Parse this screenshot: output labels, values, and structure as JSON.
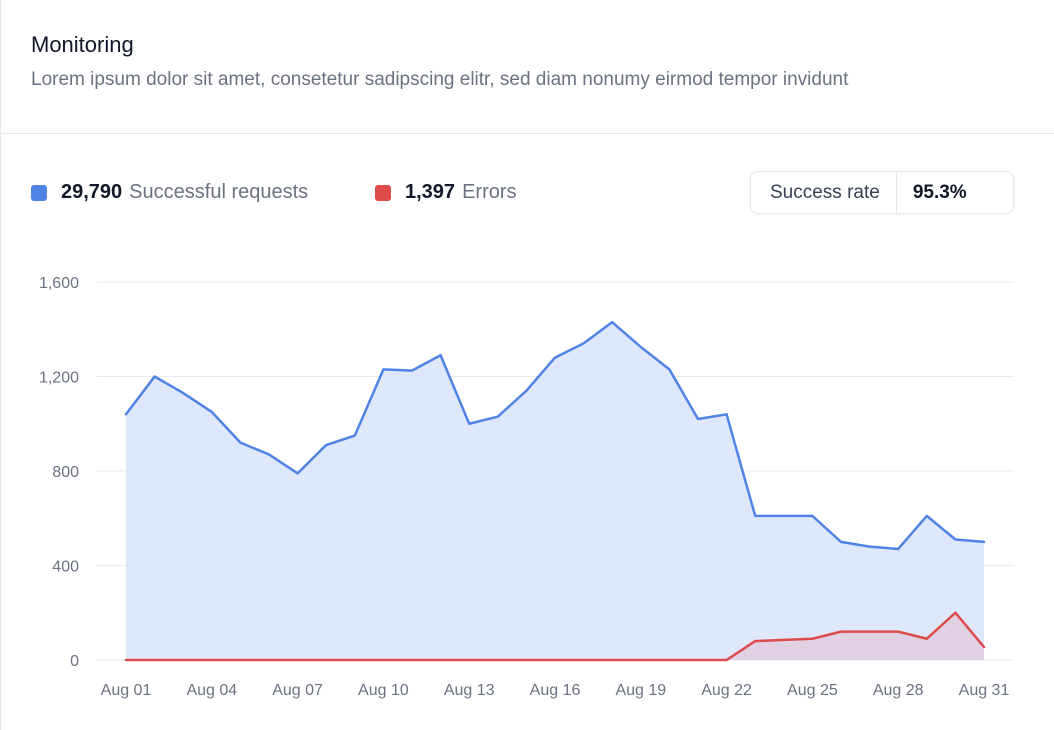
{
  "header": {
    "title": "Monitoring",
    "subtitle": "Lorem ipsum dolor sit amet, consetetur sadipscing elitr, sed diam nonumy eirmod tempor invidunt"
  },
  "summary": {
    "successful_value": "29,790",
    "successful_label": "Successful requests",
    "errors_value": "1,397",
    "errors_label": "Errors",
    "rate_label": "Success rate",
    "rate_value": "95.3%"
  },
  "colors": {
    "success": "#4f83e6",
    "errors": "#dd4b4b",
    "success_fill": "#dfe7fb",
    "errors_fill": "#e3cde0",
    "grid": "#e8eaee"
  },
  "chart_data": {
    "type": "area",
    "x": [
      "Aug 01",
      "Aug 02",
      "Aug 03",
      "Aug 04",
      "Aug 05",
      "Aug 06",
      "Aug 07",
      "Aug 08",
      "Aug 09",
      "Aug 10",
      "Aug 11",
      "Aug 12",
      "Aug 13",
      "Aug 14",
      "Aug 15",
      "Aug 16",
      "Aug 17",
      "Aug 18",
      "Aug 19",
      "Aug 20",
      "Aug 21",
      "Aug 22",
      "Aug 23",
      "Aug 24",
      "Aug 25",
      "Aug 26",
      "Aug 27",
      "Aug 28",
      "Aug 29",
      "Aug 30",
      "Aug 31"
    ],
    "x_tick_labels": [
      "Aug 01",
      "Aug 04",
      "Aug 07",
      "Aug 10",
      "Aug 13",
      "Aug 16",
      "Aug 19",
      "Aug 22",
      "Aug 25",
      "Aug 28",
      "Aug 31"
    ],
    "y_ticks": [
      "1,600",
      "1,200",
      "800",
      "400",
      "0"
    ],
    "y_tick_values": [
      1600,
      1200,
      800,
      400,
      0
    ],
    "ylim": [
      0,
      1600
    ],
    "grid": true,
    "series": [
      {
        "name": "Successful requests",
        "values": [
          1040,
          1200,
          1130,
          1050,
          920,
          870,
          790,
          910,
          950,
          1230,
          1225,
          1290,
          1000,
          1030,
          1140,
          1280,
          1340,
          1430,
          1325,
          1230,
          1020,
          1040,
          610,
          610,
          610,
          500,
          480,
          470,
          610,
          510,
          500
        ]
      },
      {
        "name": "Errors",
        "values": [
          0,
          0,
          0,
          0,
          0,
          0,
          0,
          0,
          0,
          0,
          0,
          0,
          0,
          0,
          0,
          0,
          0,
          0,
          0,
          0,
          0,
          0,
          80,
          85,
          90,
          120,
          120,
          120,
          90,
          200,
          55
        ]
      }
    ]
  }
}
